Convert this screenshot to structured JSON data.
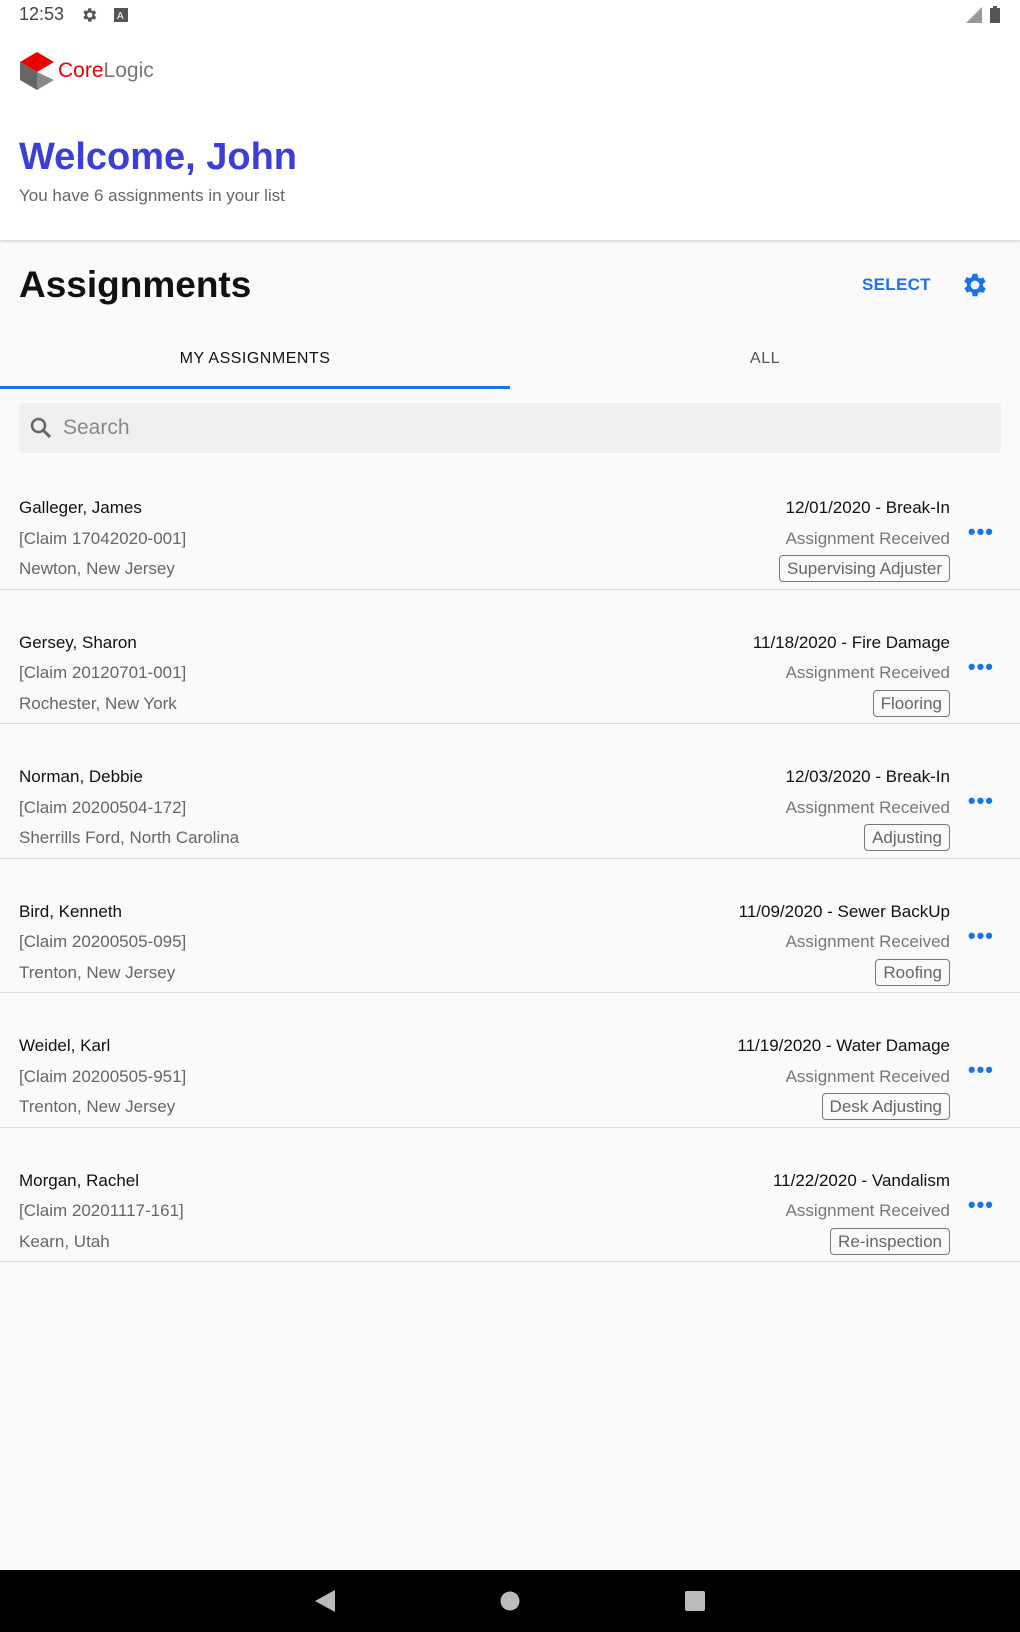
{
  "status_bar": {
    "time": "12:53"
  },
  "brand": {
    "logo_core": "Core",
    "logo_logic": "Logic"
  },
  "header": {
    "welcome": "Welcome, John",
    "subtitle": "You have 6 assignments in your list"
  },
  "assignments": {
    "title": "Assignments",
    "select_label": "SELECT"
  },
  "tabs": [
    {
      "label": "MY ASSIGNMENTS"
    },
    {
      "label": "ALL"
    }
  ],
  "search": {
    "placeholder": "Search",
    "value": ""
  },
  "items": [
    {
      "name": "Galleger, James",
      "claim": "[Claim 17042020-001]",
      "location": "Newton, New Jersey",
      "date_type": "12/01/2020 - Break-In",
      "status": "Assignment Received",
      "tag": "Supervising Adjuster"
    },
    {
      "name": "Gersey, Sharon",
      "claim": "[Claim 20120701-001]",
      "location": "Rochester, New York",
      "date_type": "11/18/2020 - Fire Damage",
      "status": "Assignment Received",
      "tag": "Flooring"
    },
    {
      "name": "Norman, Debbie",
      "claim": "[Claim 20200504-172]",
      "location": "Sherrills Ford, North Carolina",
      "date_type": "12/03/2020 - Break-In",
      "status": "Assignment Received",
      "tag": "Adjusting"
    },
    {
      "name": "Bird, Kenneth",
      "claim": "[Claim 20200505-095]",
      "location": "Trenton, New Jersey",
      "date_type": "11/09/2020 - Sewer BackUp",
      "status": "Assignment Received",
      "tag": "Roofing"
    },
    {
      "name": "Weidel, Karl",
      "claim": "[Claim 20200505-951]",
      "location": "Trenton, New Jersey",
      "date_type": "11/19/2020 - Water Damage",
      "status": "Assignment Received",
      "tag": "Desk Adjusting"
    },
    {
      "name": "Morgan, Rachel",
      "claim": "[Claim 20201117-161]",
      "location": "Kearn, Utah",
      "date_type": "11/22/2020 - Vandalism",
      "status": "Assignment Received",
      "tag": "Re-inspection"
    }
  ],
  "colors": {
    "accent": "#1a73e8",
    "welcome": "#3b3fd6",
    "brand_red": "#e00000"
  }
}
